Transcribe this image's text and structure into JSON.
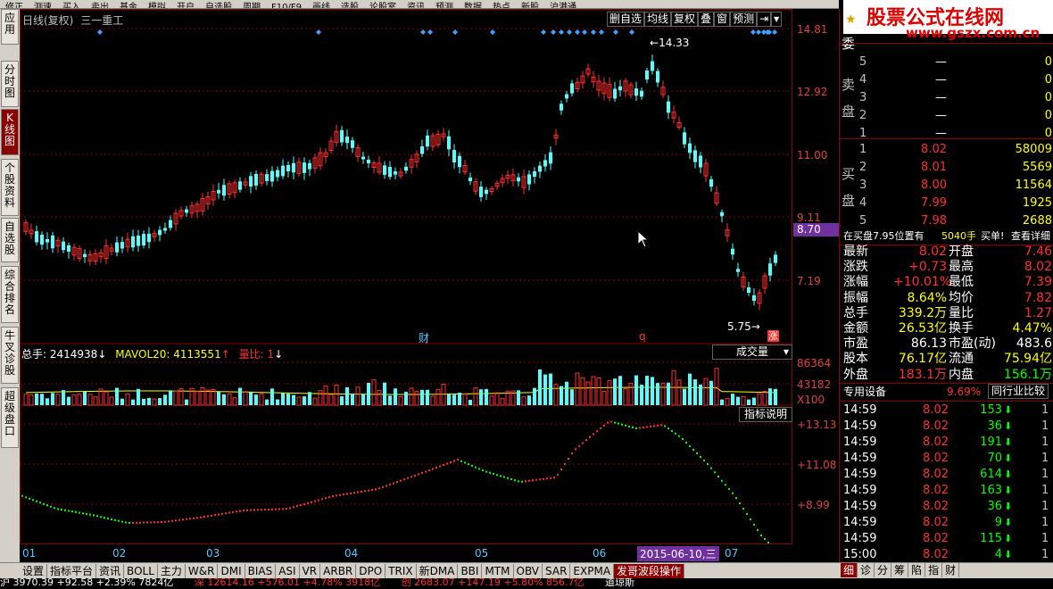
{
  "top_menu": [
    "修正",
    "测速",
    "买入",
    "卖出",
    "基金",
    "模拟",
    "开户",
    "自选股",
    "周期",
    "F10/F9",
    "画线",
    "选股",
    "论股室",
    "资讯",
    "预测",
    "数据",
    "热点",
    "新股",
    "沪港通"
  ],
  "chart_header": {
    "period_label": "日线(复权)",
    "stock_name": "三一重工"
  },
  "chart_buttons": [
    "删自选",
    "均线",
    "复权",
    "叠",
    "窗",
    "预测"
  ],
  "left_tabs": [
    {
      "label": "应用",
      "active": false
    },
    {
      "label": "分时图",
      "active": false
    },
    {
      "label": "K线图",
      "active": true
    },
    {
      "label": "个股资料",
      "active": false
    },
    {
      "label": "自选股",
      "active": false
    },
    {
      "label": "综合排名",
      "active": false
    },
    {
      "label": "牛叉诊股",
      "active": false
    },
    {
      "label": "超级盘口",
      "active": false
    }
  ],
  "price_axis": [
    "14.81",
    "12.92",
    "11.00",
    "9.11",
    "7.19"
  ],
  "current_price_tag": "8.70",
  "annotations": {
    "high_label": "14.33",
    "low_label": "5.75",
    "marker_cai": "财",
    "marker_q": "q",
    "marker_zhang": "涨"
  },
  "volume_header": {
    "total_label": "总手: 2414938",
    "mavol_label": "MAVOL20: 4113551",
    "ratio_label": "量比: 1",
    "dropdown": "成交量"
  },
  "volume_axis": [
    "86364",
    "43182",
    "X100"
  ],
  "indicator_header": {
    "help_button": "指标说明"
  },
  "indicator_axis": [
    "+13.13",
    "+11.08",
    "+8.99"
  ],
  "date_axis": [
    "01",
    "02",
    "03",
    "04",
    "05",
    "06",
    "07"
  ],
  "date_cursor": "2015-06-10,三",
  "bottom_tabs": [
    {
      "label": "设置",
      "active": false
    },
    {
      "label": "指标平台",
      "active": false
    },
    {
      "label": "资讯",
      "active": false
    },
    {
      "label": "BOLL",
      "active": false
    },
    {
      "label": "主力",
      "active": false
    },
    {
      "label": "W&R",
      "active": false
    },
    {
      "label": "DMI",
      "active": false
    },
    {
      "label": "BIAS",
      "active": false
    },
    {
      "label": "ASI",
      "active": false
    },
    {
      "label": "VR",
      "active": false
    },
    {
      "label": "ARBR",
      "active": false
    },
    {
      "label": "DPO",
      "active": false
    },
    {
      "label": "TRIX",
      "active": false
    },
    {
      "label": "新DMA",
      "active": false
    },
    {
      "label": "BBI",
      "active": false
    },
    {
      "label": "MTM",
      "active": false
    },
    {
      "label": "OBV",
      "active": false
    },
    {
      "label": "SAR",
      "active": false
    },
    {
      "label": "EXPMA",
      "active": false
    },
    {
      "label": "发哥波段操作",
      "active": true
    }
  ],
  "right_bottom_tabs": [
    "细",
    "诊",
    "分",
    "筹",
    "陷",
    "指",
    "财"
  ],
  "status_bar": {
    "item1": "沪 3970.39 +92.58 +2.39% 7824亿",
    "item2": "深 12614.16 +576.01 +4.78% 3918亿",
    "item3": "创 2683.07 +147.19 +5.80% 856.7亿",
    "item4": "道琼斯"
  },
  "logo": {
    "title": "股票公式在线网",
    "url": "www.gszx.com.cn"
  },
  "orderbook": {
    "sell_label": "卖盘",
    "buy_label": "买盘",
    "sell": [
      {
        "lv": "5",
        "price": "—",
        "vol": "0"
      },
      {
        "lv": "4",
        "price": "—",
        "vol": "0"
      },
      {
        "lv": "3",
        "price": "—",
        "vol": "0"
      },
      {
        "lv": "2",
        "price": "—",
        "vol": "0"
      },
      {
        "lv": "1",
        "price": "—",
        "vol": "0"
      }
    ],
    "buy": [
      {
        "lv": "1",
        "price": "8.02",
        "vol": "58009"
      },
      {
        "lv": "2",
        "price": "8.01",
        "vol": "5569"
      },
      {
        "lv": "3",
        "price": "8.00",
        "vol": "11564"
      },
      {
        "lv": "4",
        "price": "7.99",
        "vol": "1925"
      },
      {
        "lv": "5",
        "price": "7.98",
        "vol": "2688"
      }
    ]
  },
  "buy_info": {
    "text": "在买盘7.95位置有",
    "vol": "5040手",
    "buy": "买单!",
    "detail": "查看详细"
  },
  "quote": [
    {
      "k1": "最新",
      "v1": "8.02",
      "k2": "开盘",
      "v2": "7.46"
    },
    {
      "k1": "涨跌",
      "v1": "+0.73",
      "k2": "最高",
      "v2": "8.02"
    },
    {
      "k1": "涨幅",
      "v1": "+10.01%",
      "k2": "最低",
      "v2": "7.39"
    },
    {
      "k1": "振幅",
      "v1": "8.64%",
      "k2": "均价",
      "v2": "7.82"
    },
    {
      "k1": "总手",
      "v1": "339.2万",
      "k2": "量比",
      "v2": "1.27"
    },
    {
      "k1": "金额",
      "v1": "26.53亿",
      "k2": "换手",
      "v2": "4.47%"
    },
    {
      "k1": "市盈",
      "v1": "86.13",
      "k2": "市盈(动)",
      "v2": "483.6"
    },
    {
      "k1": "股本",
      "v1": "76.17亿",
      "k2": "流通",
      "v2": "75.94亿"
    },
    {
      "k1": "外盘",
      "v1": "183.1万",
      "k2": "内盘",
      "v2": "156.1万"
    }
  ],
  "equipment": {
    "label": "专用设备",
    "pct": "9.69%",
    "compare": "同行业比较"
  },
  "ticks": [
    {
      "time": "14:59",
      "price": "8.02",
      "vol": "153",
      "n": "1"
    },
    {
      "time": "14:59",
      "price": "8.02",
      "vol": "36",
      "n": "1"
    },
    {
      "time": "14:59",
      "price": "8.02",
      "vol": "191",
      "n": "1"
    },
    {
      "time": "14:59",
      "price": "8.02",
      "vol": "70",
      "n": "1"
    },
    {
      "time": "14:59",
      "price": "8.02",
      "vol": "614",
      "n": "1"
    },
    {
      "time": "14:59",
      "price": "8.02",
      "vol": "163",
      "n": "1"
    },
    {
      "time": "14:59",
      "price": "8.02",
      "vol": "36",
      "n": "1"
    },
    {
      "time": "14:59",
      "price": "8.02",
      "vol": "9",
      "n": "1"
    },
    {
      "time": "14:59",
      "price": "8.02",
      "vol": "115",
      "n": "1"
    },
    {
      "time": "15:00",
      "price": "8.02",
      "vol": "4",
      "n": "1"
    }
  ],
  "side_tab": "委"
}
